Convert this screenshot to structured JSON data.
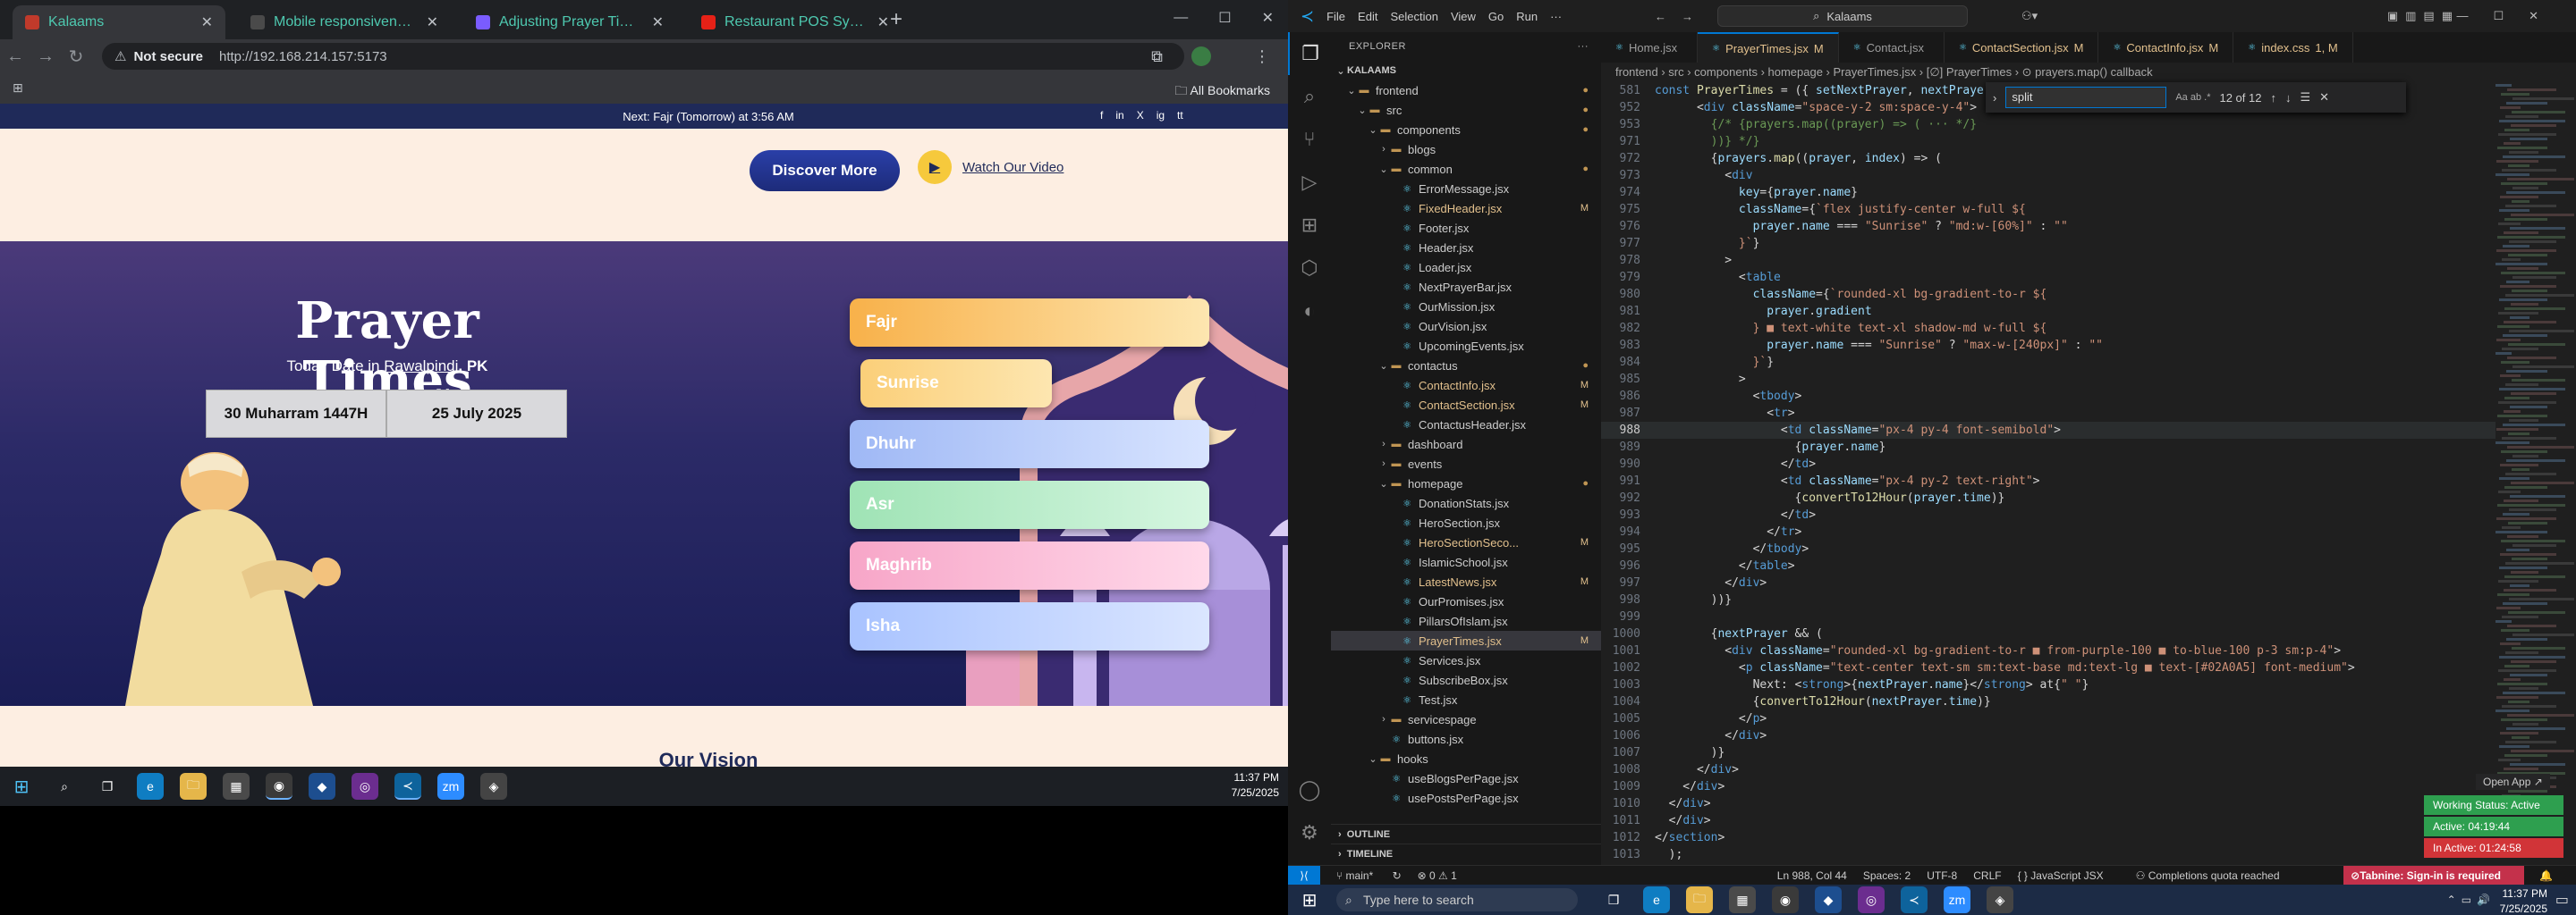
{
  "browser": {
    "tabs": [
      {
        "title": "Kalaams",
        "color": "#c03a2b"
      },
      {
        "title": "Mobile responsiveness fix",
        "color": "#4a4a4a"
      },
      {
        "title": "Adjusting Prayer Times Contain",
        "color": "#7a5cff"
      },
      {
        "title": "Restaurant POS System with",
        "color": "#e62117"
      }
    ],
    "not_secure": "Not secure",
    "url": "http://192.168.214.157:5173",
    "all_bookmarks": "All Bookmarks"
  },
  "page": {
    "announcement": "Next: Fajr (Tomorrow) at 3:56 AM",
    "social_icons": [
      "f",
      "in",
      "X",
      "ig",
      "tt"
    ],
    "discover_label": "Discover More",
    "watch_label": "Watch Our Video",
    "title": "Prayer Times",
    "today_prefix": "Today Date in",
    "city": "Rawalpindi",
    "country": ", PK",
    "hijri_date": "30 Muharram 1447H",
    "greg_date": "25 July 2025",
    "prayers": [
      {
        "name": "Fajr",
        "c1": "#f8b14a",
        "c2": "#fde6b0"
      },
      {
        "name": "Sunrise",
        "c1": "#fbcf79",
        "c2": "#fde6b0"
      },
      {
        "name": "Dhuhr",
        "c1": "#9fb8f5",
        "c2": "#d8e4ff"
      },
      {
        "name": "Asr",
        "c1": "#9fe3b5",
        "c2": "#d6f6e1"
      },
      {
        "name": "Maghrib",
        "c1": "#f7a6c8",
        "c2": "#ffd9ea"
      },
      {
        "name": "Isha",
        "c1": "#a9c3ff",
        "c2": "#dbe6ff"
      }
    ],
    "next_section_peek": "Our Vision"
  },
  "left_taskbar": {
    "time": "11:37 PM",
    "date": "7/25/2025"
  },
  "vscode": {
    "menu": [
      "File",
      "Edit",
      "Selection",
      "View",
      "Go",
      "Run",
      "···"
    ],
    "search_placeholder": "Kalaams",
    "explorer_title": "EXPLORER",
    "root": "KALAAMS",
    "tree": [
      {
        "label": "frontend",
        "indent": 1,
        "folder": true,
        "open": true,
        "mark": "●"
      },
      {
        "label": "src",
        "indent": 2,
        "folder": true,
        "open": true,
        "mark": "●"
      },
      {
        "label": "components",
        "indent": 3,
        "folder": true,
        "open": true,
        "mark": "●"
      },
      {
        "label": "blogs",
        "indent": 4,
        "folder": true,
        "open": false,
        "mark": ""
      },
      {
        "label": "common",
        "indent": 4,
        "folder": true,
        "open": true,
        "mark": "●"
      },
      {
        "label": "ErrorMessage.jsx",
        "indent": 5,
        "mark": ""
      },
      {
        "label": "FixedHeader.jsx",
        "indent": 5,
        "mark": "M"
      },
      {
        "label": "Footer.jsx",
        "indent": 5,
        "mark": ""
      },
      {
        "label": "Header.jsx",
        "indent": 5,
        "mark": ""
      },
      {
        "label": "Loader.jsx",
        "indent": 5,
        "mark": ""
      },
      {
        "label": "NextPrayerBar.jsx",
        "indent": 5,
        "mark": ""
      },
      {
        "label": "OurMission.jsx",
        "indent": 5,
        "mark": ""
      },
      {
        "label": "OurVision.jsx",
        "indent": 5,
        "mark": ""
      },
      {
        "label": "UpcomingEvents.jsx",
        "indent": 5,
        "mark": ""
      },
      {
        "label": "contactus",
        "indent": 4,
        "folder": true,
        "open": true,
        "mark": "●"
      },
      {
        "label": "ContactInfo.jsx",
        "indent": 5,
        "mark": "M"
      },
      {
        "label": "ContactSection.jsx",
        "indent": 5,
        "mark": "M"
      },
      {
        "label": "ContactusHeader.jsx",
        "indent": 5,
        "mark": ""
      },
      {
        "label": "dashboard",
        "indent": 4,
        "folder": true,
        "open": false,
        "mark": ""
      },
      {
        "label": "events",
        "indent": 4,
        "folder": true,
        "open": false,
        "mark": ""
      },
      {
        "label": "homepage",
        "indent": 4,
        "folder": true,
        "open": true,
        "mark": "●"
      },
      {
        "label": "DonationStats.jsx",
        "indent": 5,
        "mark": ""
      },
      {
        "label": "HeroSection.jsx",
        "indent": 5,
        "mark": ""
      },
      {
        "label": "HeroSectionSeco...",
        "indent": 5,
        "mark": "M"
      },
      {
        "label": "IslamicSchool.jsx",
        "indent": 5,
        "mark": ""
      },
      {
        "label": "LatestNews.jsx",
        "indent": 5,
        "mark": "M"
      },
      {
        "label": "OurPromises.jsx",
        "indent": 5,
        "mark": ""
      },
      {
        "label": "PillarsOfIslam.jsx",
        "indent": 5,
        "mark": ""
      },
      {
        "label": "PrayerTimes.jsx",
        "indent": 5,
        "mark": "M",
        "selected": true
      },
      {
        "label": "Services.jsx",
        "indent": 5,
        "mark": ""
      },
      {
        "label": "SubscribeBox.jsx",
        "indent": 5,
        "mark": ""
      },
      {
        "label": "Test.jsx",
        "indent": 5,
        "mark": ""
      },
      {
        "label": "servicespage",
        "indent": 4,
        "folder": true,
        "open": false,
        "mark": ""
      },
      {
        "label": "buttons.jsx",
        "indent": 4,
        "mark": ""
      },
      {
        "label": "hooks",
        "indent": 3,
        "folder": true,
        "open": true,
        "mark": ""
      },
      {
        "label": "useBlogsPerPage.jsx",
        "indent": 4,
        "mark": ""
      },
      {
        "label": "usePostsPerPage.jsx",
        "indent": 4,
        "mark": ""
      }
    ],
    "outline": "OUTLINE",
    "timeline": "TIMELINE",
    "tabs": [
      {
        "label": "Home.jsx",
        "mark": ""
      },
      {
        "label": "PrayerTimes.jsx",
        "mark": "M",
        "active": true
      },
      {
        "label": "Contact.jsx",
        "mark": ""
      },
      {
        "label": "ContactSection.jsx",
        "mark": "M"
      },
      {
        "label": "ContactInfo.jsx",
        "mark": "M"
      },
      {
        "label": "index.css",
        "mark": "1, M"
      }
    ],
    "breadcrumb": "frontend › src › components › homepage › PrayerTimes.jsx › [∅] PrayerTimes › ⊙ prayers.map() callback",
    "find": {
      "value": "split",
      "count": "12 of 12",
      "options": "Aa  ab  .*"
    },
    "code": [
      {
        "n": "581",
        "html": "<span class=\"k\">const</span> <span class=\"f\">PrayerTimes</span> = ({ <span class=\"a\">setNextPrayer</span>, <span class=\"a\">nextPrayer</span> }) => {"
      },
      {
        "n": "952",
        "html": "      &lt;<span class=\"k\">div</span> <span class=\"a\">className</span>=<span class=\"s\">\"space-y-2 sm:space-y-4\"</span>&gt;"
      },
      {
        "n": "953",
        "html": "        <span class=\"g\">{/* {prayers.map((prayer) => ( ··· */}</span>"
      },
      {
        "n": "971",
        "html": "        <span class=\"g\">))} */}</span>"
      },
      {
        "n": "972",
        "html": "        {<span class=\"a\">prayers</span>.<span class=\"f\">map</span>((<span class=\"a\">prayer</span>, <span class=\"a\">index</span>) => ("
      },
      {
        "n": "973",
        "html": "          &lt;<span class=\"k\">div</span>"
      },
      {
        "n": "974",
        "html": "            <span class=\"a\">key</span>={<span class=\"a\">prayer</span>.<span class=\"a\">name</span>}"
      },
      {
        "n": "975",
        "html": "            <span class=\"a\">className</span>={<span class=\"s\">`flex justify-center w-full ${</span>"
      },
      {
        "n": "976",
        "html": "              <span class=\"a\">prayer</span>.<span class=\"a\">name</span> === <span class=\"s\">\"Sunrise\"</span> ? <span class=\"s\">\"md:w-[60%]\"</span> : <span class=\"s\">\"\"</span>"
      },
      {
        "n": "977",
        "html": "            <span class=\"s\">}`</span>}"
      },
      {
        "n": "978",
        "html": "          &gt;"
      },
      {
        "n": "979",
        "html": "            &lt;<span class=\"k\">table</span>"
      },
      {
        "n": "980",
        "html": "              <span class=\"a\">className</span>={<span class=\"s\">`rounded-xl bg-gradient-to-r ${</span>"
      },
      {
        "n": "981",
        "html": "                <span class=\"a\">prayer</span>.<span class=\"a\">gradient</span>"
      },
      {
        "n": "982",
        "html": "              <span class=\"s\">} ■ text-white text-xl shadow-md w-full ${</span>"
      },
      {
        "n": "983",
        "html": "                <span class=\"a\">prayer</span>.<span class=\"a\">name</span> === <span class=\"s\">\"Sunrise\"</span> ? <span class=\"s\">\"max-w-[240px]\"</span> : <span class=\"s\">\"\"</span>"
      },
      {
        "n": "984",
        "html": "              <span class=\"s\">}`</span>}"
      },
      {
        "n": "985",
        "html": "            &gt;"
      },
      {
        "n": "986",
        "html": "              &lt;<span class=\"k\">tbody</span>&gt;"
      },
      {
        "n": "987",
        "html": "                &lt;<span class=\"k\">tr</span>&gt;"
      },
      {
        "n": "988",
        "html": "                  &lt;<span class=\"k\">td</span> <span class=\"a\">className</span>=<span class=\"s\">\"px-4 py-4 font-semibold\"</span>&gt;",
        "cur": true
      },
      {
        "n": "989",
        "html": "                    {<span class=\"a\">prayer</span>.<span class=\"a\">name</span>}"
      },
      {
        "n": "990",
        "html": "                  &lt;/<span class=\"k\">td</span>&gt;"
      },
      {
        "n": "991",
        "html": "                  &lt;<span class=\"k\">td</span> <span class=\"a\">className</span>=<span class=\"s\">\"px-4 py-2 text-right\"</span>&gt;"
      },
      {
        "n": "992",
        "html": "                    {<span class=\"f\">convertTo12Hour</span>(<span class=\"a\">prayer</span>.<span class=\"a\">time</span>)}"
      },
      {
        "n": "993",
        "html": "                  &lt;/<span class=\"k\">td</span>&gt;"
      },
      {
        "n": "994",
        "html": "                &lt;/<span class=\"k\">tr</span>&gt;"
      },
      {
        "n": "995",
        "html": "              &lt;/<span class=\"k\">tbody</span>&gt;"
      },
      {
        "n": "996",
        "html": "            &lt;/<span class=\"k\">table</span>&gt;"
      },
      {
        "n": "997",
        "html": "          &lt;/<span class=\"k\">div</span>&gt;"
      },
      {
        "n": "998",
        "html": "        ))}"
      },
      {
        "n": "999",
        "html": ""
      },
      {
        "n": "1000",
        "html": "        {<span class=\"a\">nextPrayer</span> &amp;&amp; ("
      },
      {
        "n": "1001",
        "html": "          &lt;<span class=\"k\">div</span> <span class=\"a\">className</span>=<span class=\"s\">\"rounded-xl bg-gradient-to-r ■ from-purple-100 ■ to-blue-100 p-3 sm:p-4\"</span>&gt;"
      },
      {
        "n": "1002",
        "html": "            &lt;<span class=\"k\">p</span> <span class=\"a\">className</span>=<span class=\"s\">\"text-center text-sm sm:text-base md:text-lg ■ text-[#02A0A5] font-medium\"</span>&gt;"
      },
      {
        "n": "1003",
        "html": "              Next: &lt;<span class=\"k\">strong</span>&gt;{<span class=\"a\">nextPrayer</span>.<span class=\"a\">name</span>}&lt;/<span class=\"k\">strong</span>&gt; at{<span class=\"s\">\" \"</span>}"
      },
      {
        "n": "1004",
        "html": "              {<span class=\"f\">convertTo12Hour</span>(<span class=\"a\">nextPrayer</span>.<span class=\"a\">time</span>)}"
      },
      {
        "n": "1005",
        "html": "            &lt;/<span class=\"k\">p</span>&gt;"
      },
      {
        "n": "1006",
        "html": "          &lt;/<span class=\"k\">div</span>&gt;"
      },
      {
        "n": "1007",
        "html": "        )}"
      },
      {
        "n": "1008",
        "html": "      &lt;/<span class=\"k\">div</span>&gt;"
      },
      {
        "n": "1009",
        "html": "    &lt;/<span class=\"k\">div</span>&gt;"
      },
      {
        "n": "1010",
        "html": "  &lt;/<span class=\"k\">div</span>&gt;"
      },
      {
        "n": "1011",
        "html": "  &lt;/<span class=\"k\">div</span>&gt;"
      },
      {
        "n": "1012",
        "html": "&lt;/<span class=\"k\">section</span>&gt;"
      },
      {
        "n": "1013",
        "html": "  );"
      }
    ],
    "status": {
      "branch": "main*",
      "problems": "⊗ 0 ⚠ 1",
      "position": "Ln 988, Col 44",
      "spaces": "Spaces: 2",
      "encoding": "UTF-8",
      "eol": "CRLF",
      "language": "JavaScript JSX",
      "quota": "Completions quota reached",
      "tabnine": "Tabnine: Sign-in is required"
    },
    "work_status": {
      "working": "Working Status: Active",
      "active": "Active: 04:19:44",
      "inactive": "In Active: 01:24:58"
    },
    "open_app": "Open App ↗"
  },
  "right_taskbar": {
    "search": "Type here to search",
    "time": "11:37 PM",
    "date": "7/25/2025"
  }
}
